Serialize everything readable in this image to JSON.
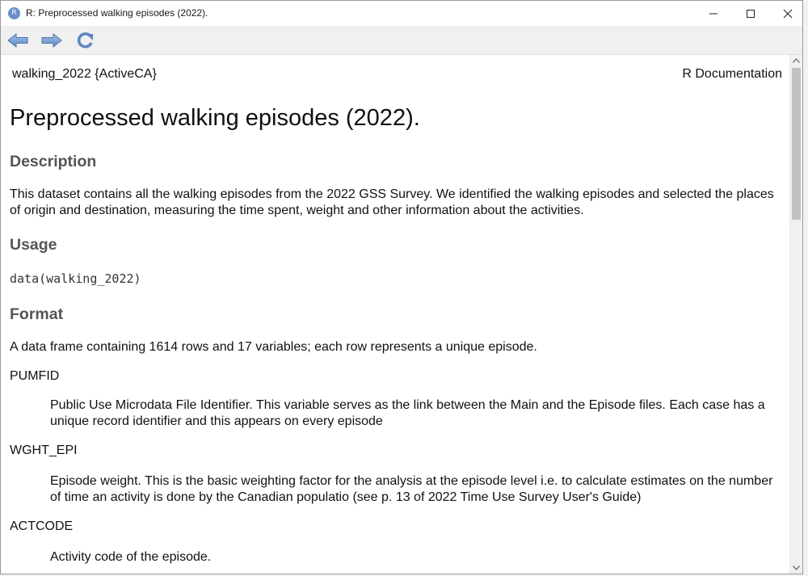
{
  "window": {
    "title": "R: Preprocessed walking episodes (2022).",
    "app_icon_letter": "R"
  },
  "toolbar": {
    "back_icon": "arrow-left-icon",
    "forward_icon": "arrow-right-icon",
    "refresh_icon": "refresh-icon"
  },
  "doc": {
    "header_left": "walking_2022 {ActiveCA}",
    "header_right": "R Documentation",
    "title": "Preprocessed walking episodes (2022).",
    "description_heading": "Description",
    "description_text": "This dataset contains all the walking episodes from the 2022 GSS Survey. We identified the walking episodes and selected the places of origin and destination, measuring the time spent, weight and other information about the activities.",
    "usage_heading": "Usage",
    "usage_code": "data(walking_2022)",
    "format_heading": "Format",
    "format_text": "A data frame containing 1614 rows and 17 variables; each row represents a unique episode.",
    "variables": [
      {
        "name": "PUMFID",
        "desc": "Public Use Microdata File Identifier. This variable serves as the link between the Main and the Episode files. Each case has a unique record identifier and this appears on every episode"
      },
      {
        "name": "WGHT_EPI",
        "desc": "Episode weight. This is the basic weighting factor for the analysis at the episode level i.e. to calculate estimates on the number of time an activity is done by the Canadian populatio (see p. 13 of 2022 Time Use Survey User's Guide)"
      },
      {
        "name": "ACTCODE",
        "desc": "Activity code of the episode."
      }
    ]
  }
}
